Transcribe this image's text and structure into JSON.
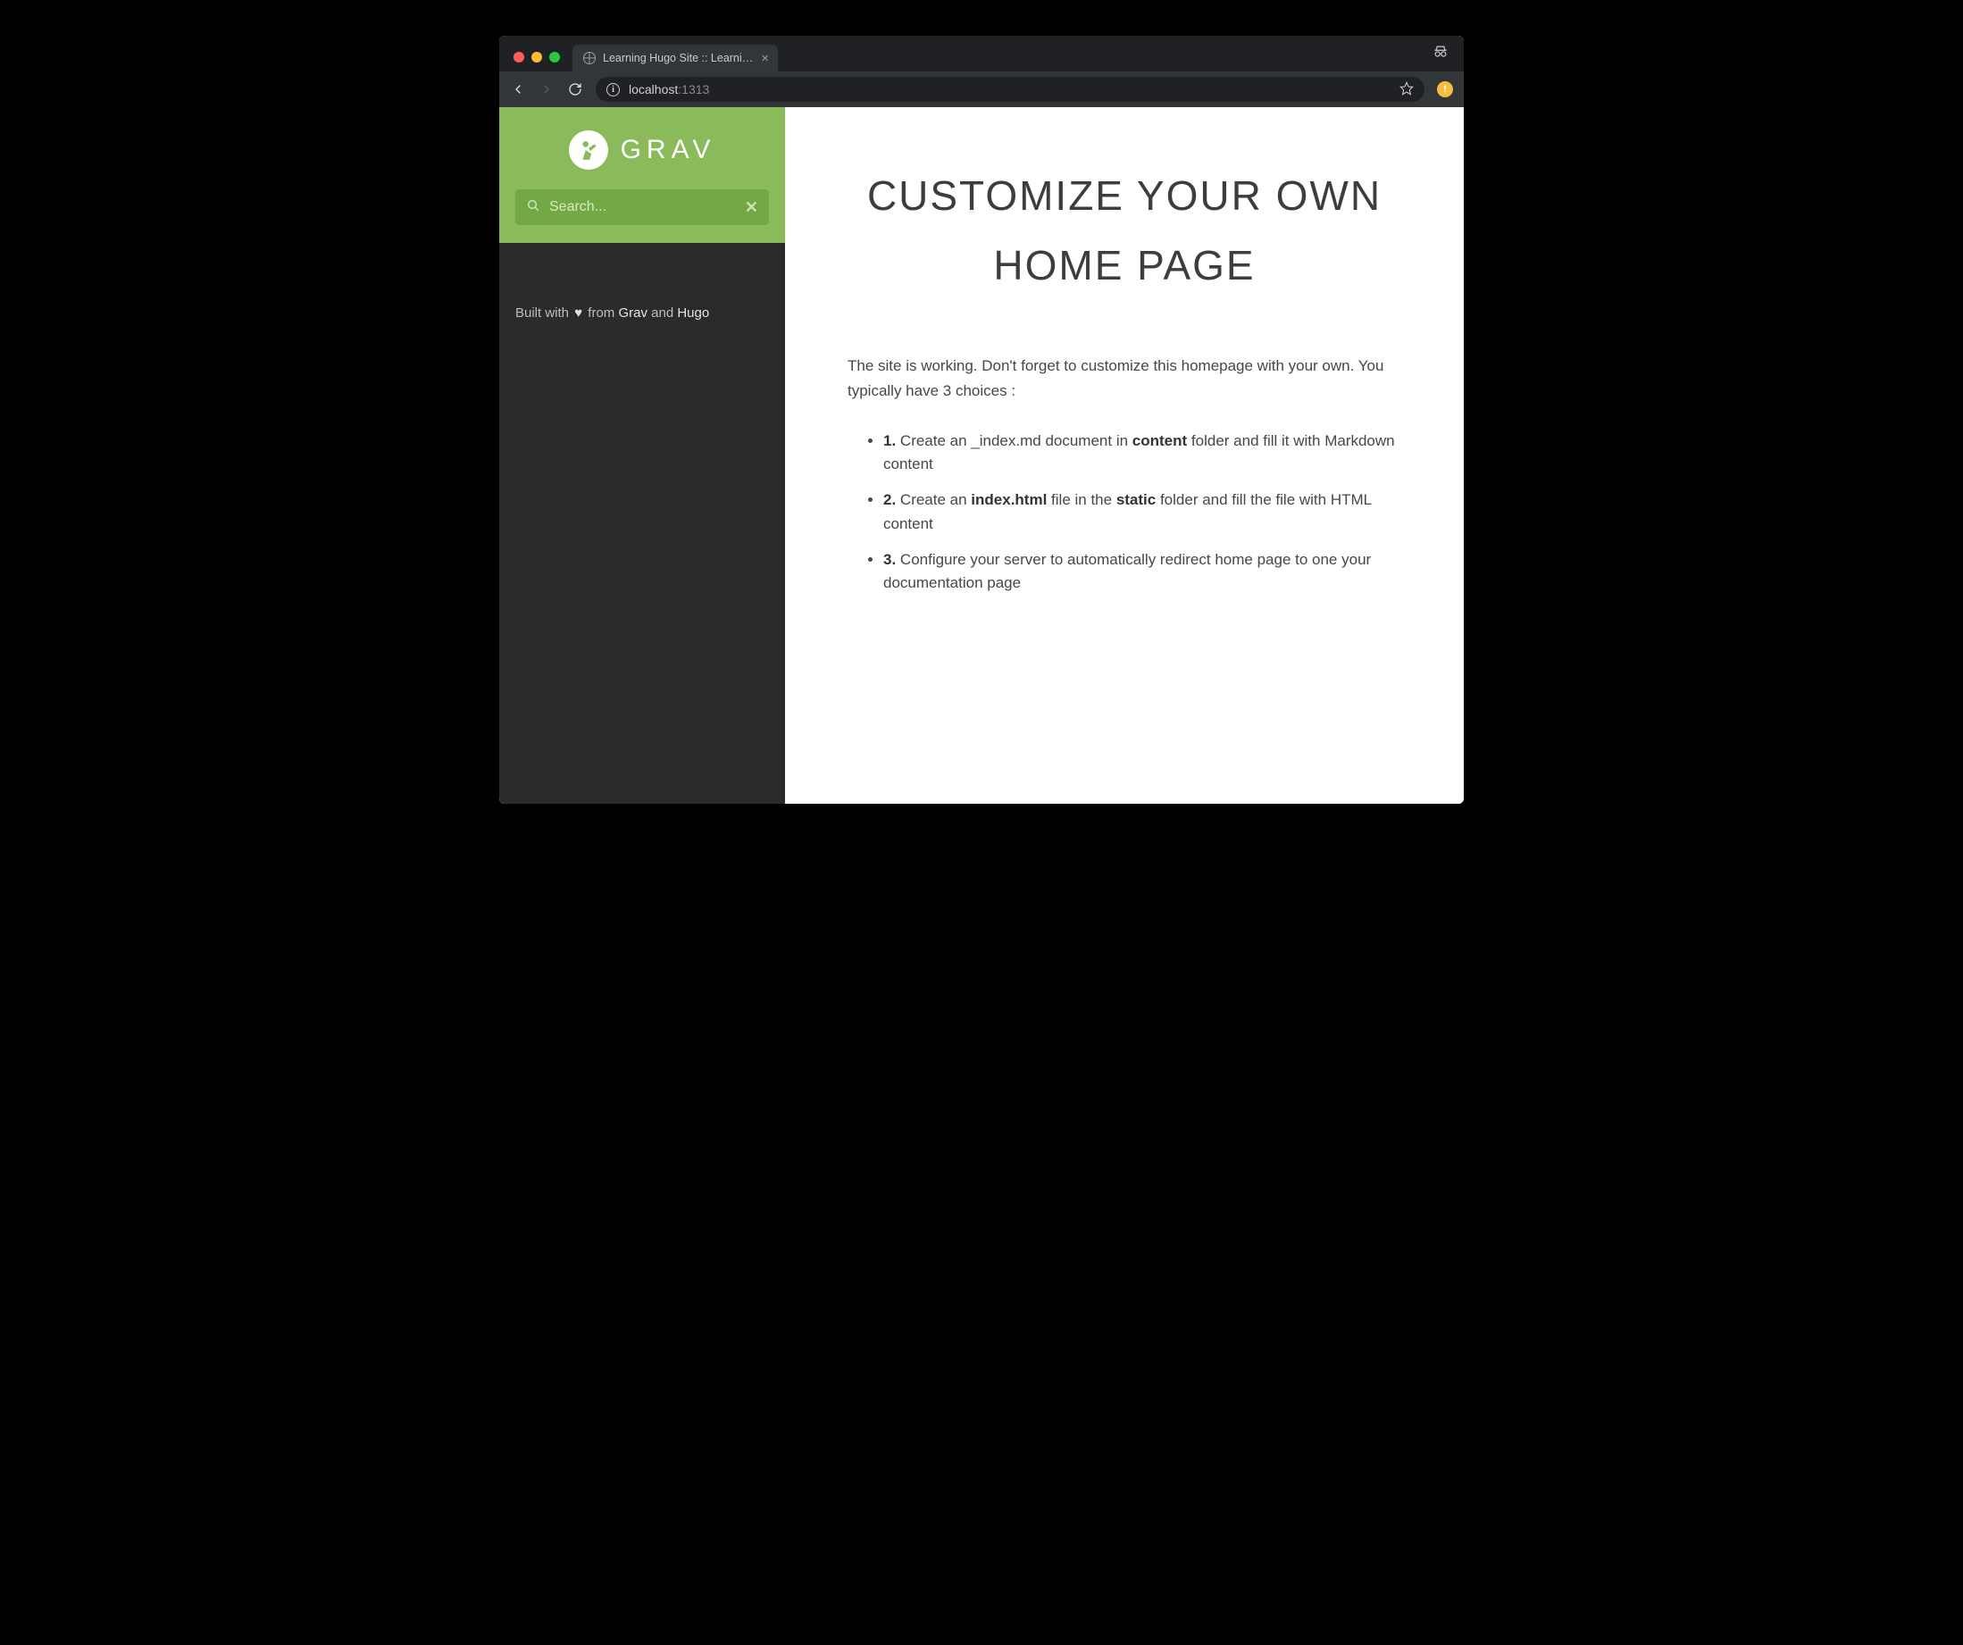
{
  "browser": {
    "tab_title": "Learning Hugo Site :: Learning",
    "url_host": "localhost",
    "url_port": ":1313"
  },
  "sidebar": {
    "logo_text": "GRAV",
    "search_placeholder": "Search...",
    "footer_prefix": "Built with ",
    "footer_mid": " from ",
    "footer_link1": "Grav",
    "footer_and": " and ",
    "footer_link2": "Hugo"
  },
  "content": {
    "heading": "CUSTOMIZE YOUR OWN HOME PAGE",
    "intro": "The site is working. Don't forget to customize this homepage with your own. You typically have 3 choices :",
    "items": [
      {
        "num": "1.",
        "pre": " Create an _index.md document in ",
        "b1": "content",
        "post": " folder and fill it with Markdown content"
      },
      {
        "num": "2.",
        "pre": " Create an ",
        "b1": "index.html",
        "mid": " file in the ",
        "b2": "static",
        "post": " folder and fill the file with HTML content"
      },
      {
        "num": "3.",
        "pre": " Configure your server to automatically redirect home page to one your documentation page"
      }
    ]
  }
}
